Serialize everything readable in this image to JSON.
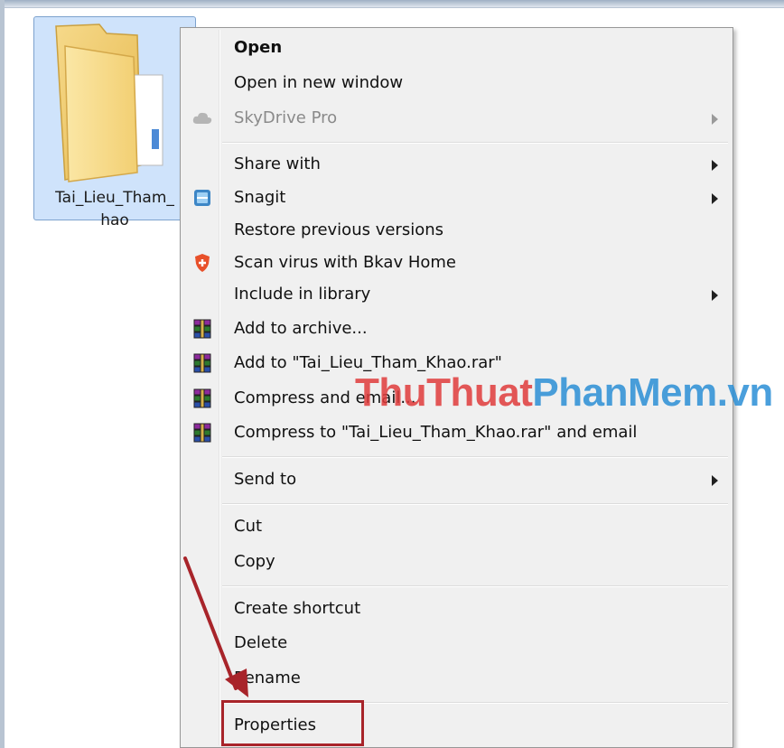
{
  "folder": {
    "name_line1": "Tai_Lieu_Tham_",
    "name_line2": "hao"
  },
  "menu": {
    "open": "Open",
    "open_new_window": "Open in new window",
    "skydrive": "SkyDrive Pro",
    "share_with": "Share with",
    "snagit": "Snagit",
    "restore": "Restore previous versions",
    "scan_virus": "Scan virus with Bkav Home",
    "include_library": "Include in library",
    "add_archive": "Add to archive...",
    "add_to_rar": "Add to \"Tai_Lieu_Tham_Khao.rar\"",
    "compress_email": "Compress and email...",
    "compress_rar_email": "Compress to \"Tai_Lieu_Tham_Khao.rar\" and email",
    "send_to": "Send to",
    "cut": "Cut",
    "copy": "Copy",
    "create_shortcut": "Create shortcut",
    "delete": "Delete",
    "rename": "Rename",
    "properties": "Properties"
  },
  "watermark": {
    "part1": "ThuThuat",
    "part2": "PhanMem.vn"
  },
  "colors": {
    "highlight": "#a8242a",
    "watermark_red": "#e03c3c",
    "watermark_blue": "#2b8fd6",
    "selection": "#cfe3fb"
  }
}
